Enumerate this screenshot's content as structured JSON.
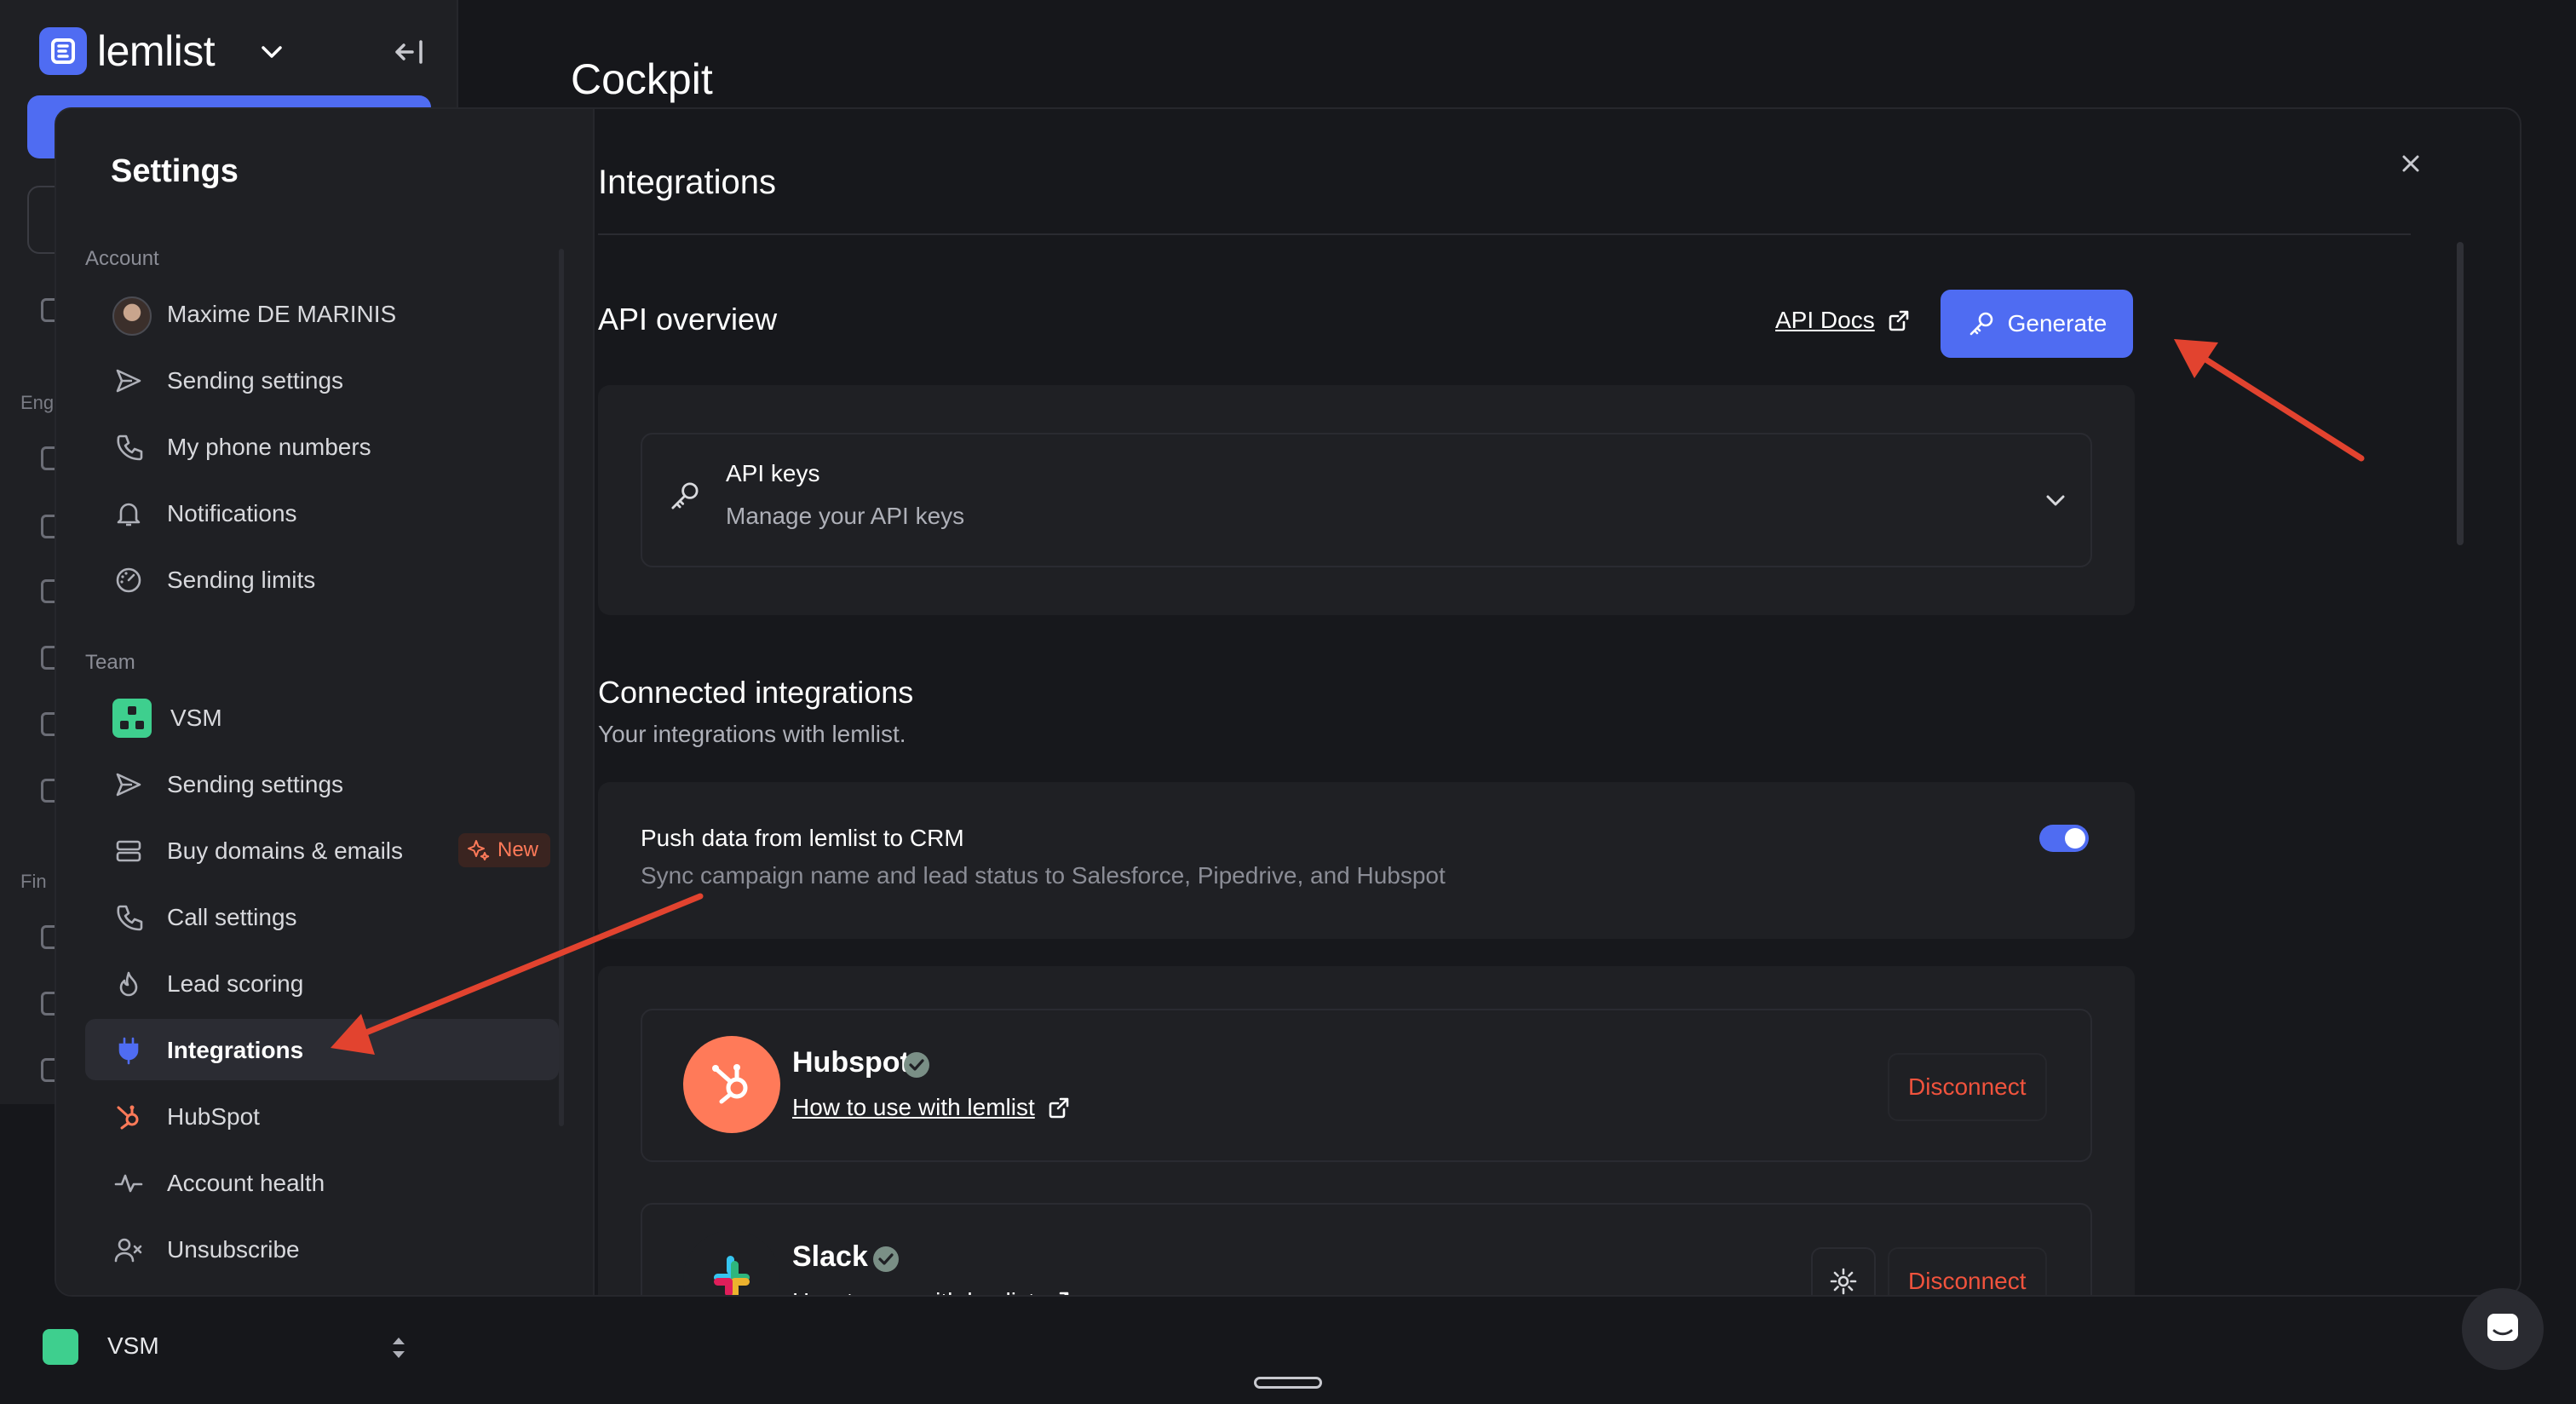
{
  "app": {
    "brand": "lemlist",
    "page_title": "Cockpit",
    "peek_sections": [
      "Eng",
      "Fin"
    ],
    "workspace": "VSM"
  },
  "settings": {
    "title": "Settings",
    "sections": {
      "account": "Account",
      "team": "Team"
    },
    "account_items": [
      {
        "label": "Maxime DE MARINIS",
        "icon": "avatar"
      },
      {
        "label": "Sending settings",
        "icon": "send-icon"
      },
      {
        "label": "My phone numbers",
        "icon": "phone-icon"
      },
      {
        "label": "Notifications",
        "icon": "bell-icon"
      },
      {
        "label": "Sending limits",
        "icon": "gauge-icon"
      }
    ],
    "team_items": [
      {
        "label": "VSM",
        "icon": "workspace-icon"
      },
      {
        "label": "Sending settings",
        "icon": "send-icon"
      },
      {
        "label": "Buy domains & emails",
        "icon": "server-icon",
        "badge": "New"
      },
      {
        "label": "Call settings",
        "icon": "phone-icon"
      },
      {
        "label": "Lead scoring",
        "icon": "flame-icon"
      },
      {
        "label": "Integrations",
        "icon": "plug-icon",
        "active": true
      },
      {
        "label": "HubSpot",
        "icon": "hubspot-icon"
      },
      {
        "label": "Account health",
        "icon": "pulse-icon"
      },
      {
        "label": "Unsubscribe",
        "icon": "user-x-icon"
      }
    ]
  },
  "content": {
    "title": "Integrations",
    "api": {
      "heading": "API overview",
      "docs_link": "API Docs",
      "generate_label": "Generate",
      "keys_title": "API keys",
      "keys_subtitle": "Manage your API keys"
    },
    "connected": {
      "heading": "Connected integrations",
      "subtitle": "Your integrations with lemlist.",
      "crm_title": "Push data from lemlist to CRM",
      "crm_subtitle": "Sync campaign name and lead status to Salesforce, Pipedrive, and Hubspot",
      "crm_enabled": true
    },
    "integrations": [
      {
        "name": "Hubspot",
        "link": "How to use with lemlist",
        "action": "Disconnect",
        "brand_color": "#ff7a59"
      },
      {
        "name": "Slack",
        "link": "How to use with lemlist",
        "action": "Disconnect",
        "brand_color": "#e01e5a"
      }
    ]
  },
  "colors": {
    "accent": "#4f6cf2",
    "danger": "#f0533d",
    "annotation_arrow": "#e2432f",
    "success": "#3ecf8e"
  }
}
